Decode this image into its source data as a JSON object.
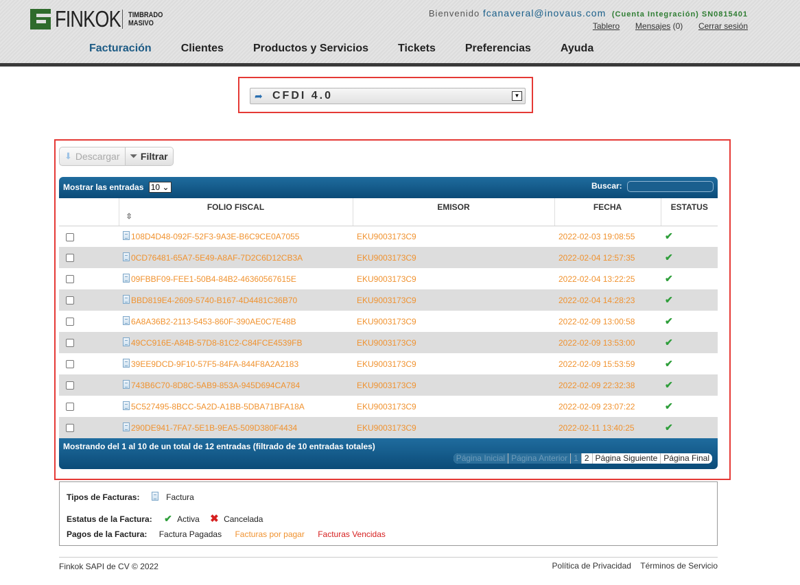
{
  "brand": {
    "name": "FINKOK",
    "sub_line1": "TIMBRADO",
    "sub_line2": "MASIVO"
  },
  "header": {
    "welcome": "Bienvenido",
    "email": "fcanaveral@inovaus.com",
    "account": "(Cuenta Integración) SN0815401",
    "links": {
      "tablero": "Tablero",
      "mensajes": "Mensajes",
      "mensajes_count": "(0)",
      "logout": "Cerrar sesión"
    }
  },
  "nav": [
    "Facturación",
    "Clientes",
    "Productos y Servicios",
    "Tickets",
    "Preferencias",
    "Ayuda"
  ],
  "cfdi": {
    "label": "CFDI 4.0"
  },
  "toolbar": {
    "download": "Descargar",
    "filter": "Filtrar"
  },
  "table": {
    "length_label": "Mostrar las entradas",
    "length_value": "10",
    "search_label": "Buscar:",
    "columns": [
      "FOLIO FISCAL",
      "EMISOR",
      "FECHA",
      "ESTATUS"
    ],
    "rows": [
      {
        "folio": "108D4D48-092F-52F3-9A3E-B6C9CE0A7055",
        "emisor": "EKU9003173C9",
        "fecha": "2022-02-03 19:08:55"
      },
      {
        "folio": "0CD76481-65A7-5E49-A8AF-7D2C6D12CB3A",
        "emisor": "EKU9003173C9",
        "fecha": "2022-02-04 12:57:35"
      },
      {
        "folio": "09FBBF09-FEE1-50B4-84B2-46360567615E",
        "emisor": "EKU9003173C9",
        "fecha": "2022-02-04 13:22:25"
      },
      {
        "folio": "BBD819E4-2609-5740-B167-4D4481C36B70",
        "emisor": "EKU9003173C9",
        "fecha": "2022-02-04 14:28:23"
      },
      {
        "folio": "6A8A36B2-2113-5453-860F-390AE0C7E48B",
        "emisor": "EKU9003173C9",
        "fecha": "2022-02-09 13:00:58"
      },
      {
        "folio": "49CC916E-A84B-57D8-81C2-C84FCE4539FB",
        "emisor": "EKU9003173C9",
        "fecha": "2022-02-09 13:53:00"
      },
      {
        "folio": "39EE9DCD-9F10-57F5-84FA-844F8A2A2183",
        "emisor": "EKU9003173C9",
        "fecha": "2022-02-09 15:53:59"
      },
      {
        "folio": "743B6C70-8D8C-5AB9-853A-945D694CA784",
        "emisor": "EKU9003173C9",
        "fecha": "2022-02-09 22:32:38"
      },
      {
        "folio": "5C527495-8BCC-5A2D-A1BB-5DBA71BFA18A",
        "emisor": "EKU9003173C9",
        "fecha": "2022-02-09 23:07:22"
      },
      {
        "folio": "290DE941-7FA7-5E1B-9EA5-509D380F4434",
        "emisor": "EKU9003173C9",
        "fecha": "2022-02-11 13:40:25"
      }
    ],
    "info": "Mostrando del 1 al 10 de un total de 12 entradas (filtrado de 10 entradas totales)",
    "pager": {
      "first": "Página Inicial",
      "prev": "Página Anterior",
      "p1": "1",
      "p2": "2",
      "next": "Página Siguiente",
      "last": "Página Final"
    }
  },
  "legend": {
    "types_label": "Tipos de Facturas:",
    "types_value": "Factura",
    "status_label": "Estatus de la Factura:",
    "status_active": "Activa",
    "status_cancelled": "Cancelada",
    "payments_label": "Pagos de la Factura:",
    "paid": "Factura Pagadas",
    "to_pay": "Facturas por pagar",
    "overdue": "Facturas Vencidas"
  },
  "footer": {
    "copyright": "Finkok SAPI de CV © 2022",
    "privacy": "Política de Privacidad",
    "terms": "Términos de Servicio"
  },
  "colors": {
    "primary": "#1d5b85",
    "accent_orange": "#f0922f",
    "ok_green": "#2e9e3a",
    "error_red": "#d62020"
  }
}
